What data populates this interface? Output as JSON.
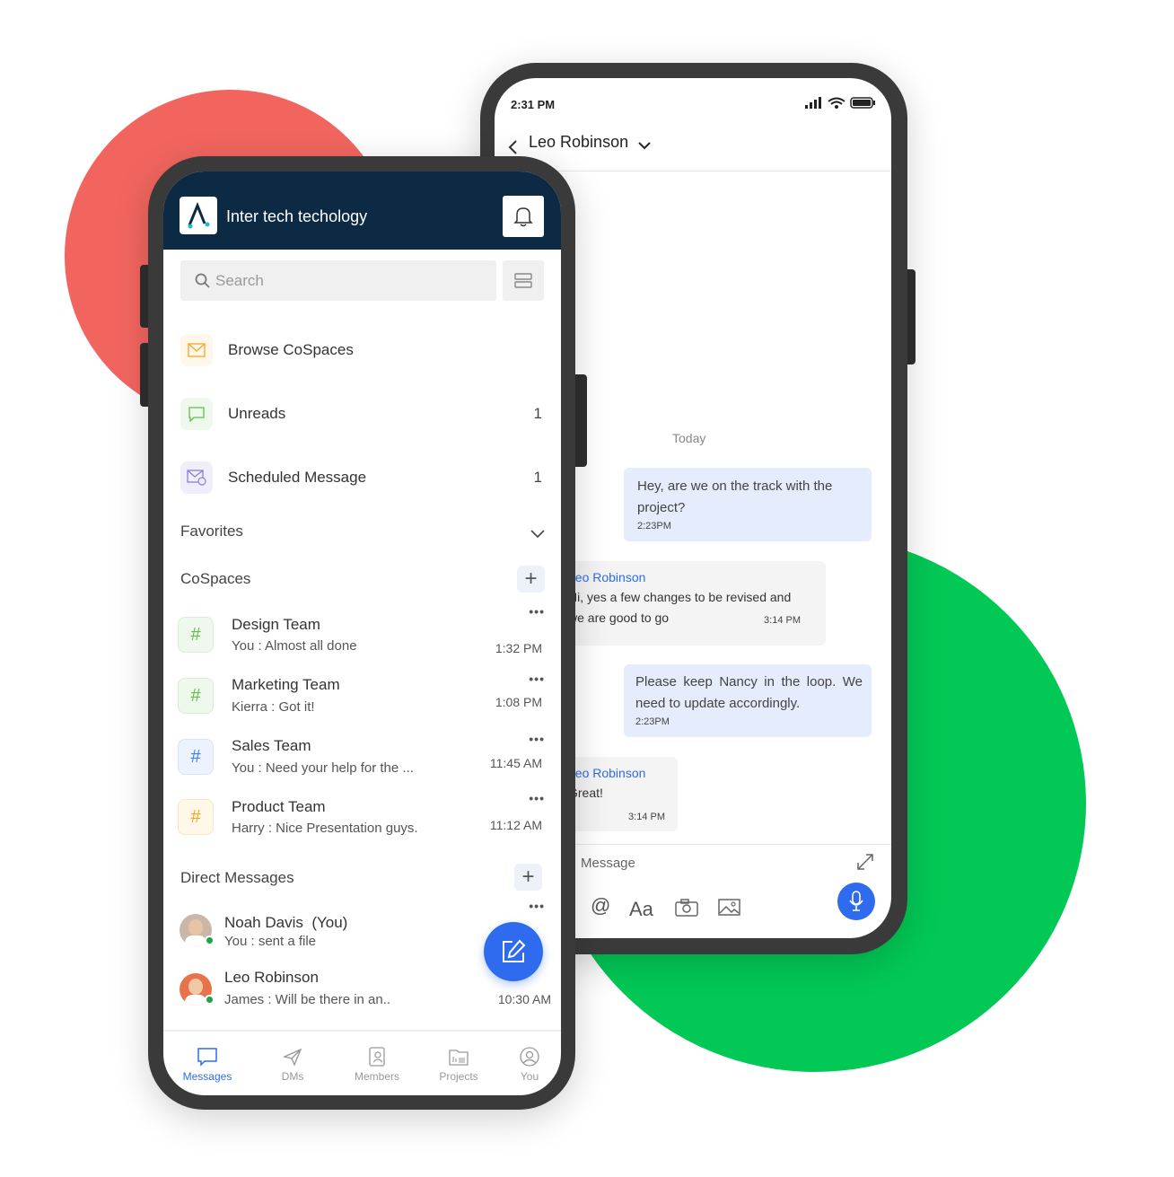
{
  "colors": {
    "accent": "#2f6bef",
    "header": "#0c2a43",
    "red_blob": "#f2655f",
    "green_blob": "#02c856"
  },
  "chat": {
    "status_time": "2:31 PM",
    "contact": "Leo Robinson",
    "date_divider": "Today",
    "messages": [
      {
        "type": "outgoing",
        "text": "Hey, are we on the track with the project?",
        "time": "2:23PM"
      },
      {
        "type": "incoming",
        "sender": "Leo Robinson",
        "text": "Hi, yes a few changes to be revised and we are good to go",
        "time": "3:14 PM"
      },
      {
        "type": "outgoing",
        "text": "Please keep Nancy in the loop. We need to update accordingly.",
        "time": "2:23PM"
      },
      {
        "type": "incoming",
        "sender": "Leo Robinson",
        "text": "Great!",
        "time": "3:14 PM"
      }
    ],
    "input_placeholder": "Message",
    "format_label": "Aa",
    "mention_label": "@"
  },
  "app": {
    "workspace": "Inter tech techology",
    "search_placeholder": "Search",
    "menu": [
      {
        "label": "Browse CoSpaces",
        "count": ""
      },
      {
        "label": "Unreads",
        "count": "1"
      },
      {
        "label": "Scheduled Message",
        "count": "1"
      }
    ],
    "favorites_label": "Favorites",
    "cospaces_label": "CoSpaces",
    "cospaces": [
      {
        "name": "Design Team",
        "preview": "You : Almost all done",
        "time": "1:32 PM",
        "color": "#5fbf4a",
        "bg": "#eef8ec"
      },
      {
        "name": "Marketing Team",
        "preview": "Kierra : Got it!",
        "time": "1:08 PM",
        "color": "#5fbf4a",
        "bg": "#eef8ec"
      },
      {
        "name": "Sales Team",
        "preview": "You : Need your help for the ...",
        "time": "11:45 AM",
        "color": "#3b82f6",
        "bg": "#edf3fe"
      },
      {
        "name": "Product Team",
        "preview": "Harry : Nice Presentation guys.",
        "time": "11:12 AM",
        "color": "#f5a623",
        "bg": "#fff7e8"
      }
    ],
    "dm_label": "Direct Messages",
    "dms": [
      {
        "name": "Noah Davis  (You)",
        "preview": "You : sent a file",
        "time": ""
      },
      {
        "name": "Leo Robinson",
        "preview": "James : Will be there in an..",
        "time": "10:30 AM"
      }
    ],
    "tabs": [
      {
        "label": "Messages",
        "icon": "chat-bubble-icon",
        "active": true
      },
      {
        "label": "DMs",
        "icon": "paper-plane-icon",
        "active": false
      },
      {
        "label": "Members",
        "icon": "contacts-book-icon",
        "active": false
      },
      {
        "label": "Projects",
        "icon": "folder-icon",
        "active": false
      },
      {
        "label": "You",
        "icon": "user-circle-icon",
        "active": false
      }
    ]
  }
}
